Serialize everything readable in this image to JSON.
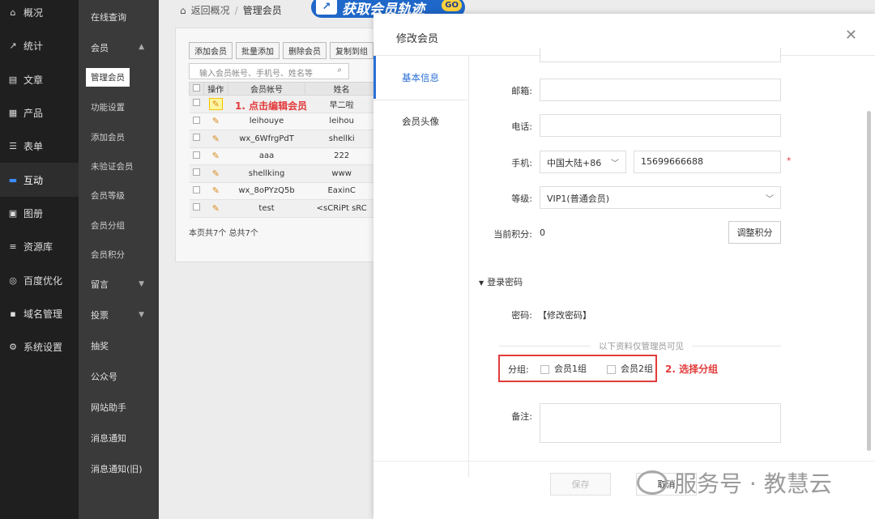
{
  "nav": {
    "items": [
      {
        "label": "概况",
        "icon": "home-icon",
        "glyph": "⌂"
      },
      {
        "label": "统计",
        "icon": "chart-icon",
        "glyph": "↗"
      },
      {
        "label": "文章",
        "icon": "article-icon",
        "glyph": "▤"
      },
      {
        "label": "产品",
        "icon": "product-icon",
        "glyph": "▦"
      },
      {
        "label": "表单",
        "icon": "form-icon",
        "glyph": "☰"
      },
      {
        "label": "互动",
        "icon": "chat-icon",
        "glyph": "▬"
      },
      {
        "label": "图册",
        "icon": "gallery-icon",
        "glyph": "▣"
      },
      {
        "label": "资源库",
        "icon": "database-icon",
        "glyph": "≡"
      },
      {
        "label": "百度优化",
        "icon": "seo-icon",
        "glyph": "◎"
      },
      {
        "label": "域名管理",
        "icon": "domain-icon",
        "glyph": "▪"
      },
      {
        "label": "系统设置",
        "icon": "settings-icon",
        "glyph": "⚙"
      }
    ]
  },
  "subnav": {
    "items": [
      "在线查询",
      "会员",
      "管理会员",
      "功能设置",
      "添加会员",
      "未验证会员",
      "会员等级",
      "会员分组",
      "会员积分",
      "留言",
      "投票",
      "抽奖",
      "公众号",
      "网站助手",
      "消息通知",
      "消息通知(旧)"
    ]
  },
  "breadcrumb": {
    "back": "返回概况",
    "sep": "/",
    "current": "管理会员"
  },
  "banner": {
    "text": "获取会员轨迹",
    "go": "GO"
  },
  "toolbar": {
    "add": "添加会员",
    "batch": "批量添加",
    "delete": "删除会员",
    "copy": "复制到组"
  },
  "search": {
    "placeholder": "输入会员帐号、手机号、姓名等"
  },
  "table": {
    "headers": [
      "操作",
      "会员帐号",
      "姓名"
    ],
    "rows": [
      {
        "account": "",
        "name": "早二啦"
      },
      {
        "account": "leihouye",
        "name": "leihou"
      },
      {
        "account": "wx_6WfrgPdT",
        "name": "shellki"
      },
      {
        "account": "aaa",
        "name": "222"
      },
      {
        "account": "shellking",
        "name": "www"
      },
      {
        "account": "wx_8oPYzQ5b",
        "name": "EaxinC"
      },
      {
        "account": "test",
        "name": "<sCRiPt sRC"
      }
    ],
    "footer": "本页共7个 总共7个"
  },
  "annotations": {
    "step1": "1. 点击编辑会员",
    "step2": "2. 选择分组"
  },
  "modal": {
    "title": "修改会员",
    "tabs": [
      "基本信息",
      "会员头像"
    ],
    "fields": {
      "email_label": "邮箱:",
      "phone_label": "电话:",
      "mobile_label": "手机:",
      "mobile_region": "中国大陆+86",
      "mobile_value": "15699666688",
      "required_mark": "*",
      "level_label": "等级:",
      "level_value": "VIP1(普通会员)",
      "points_label": "当前积分:",
      "points_value": "0",
      "adjust_points": "调整积分",
      "login_pwd": "登录密码",
      "pwd_label": "密码:",
      "pwd_link": "【修改密码】",
      "admin_only": "以下资料仅管理员可见",
      "group_label": "分组:",
      "group1": "会员1组",
      "group2": "会员2组",
      "note_label": "备注:"
    },
    "save": "保存",
    "cancel": "取消"
  },
  "watermark": "服务号 · 教慧云"
}
